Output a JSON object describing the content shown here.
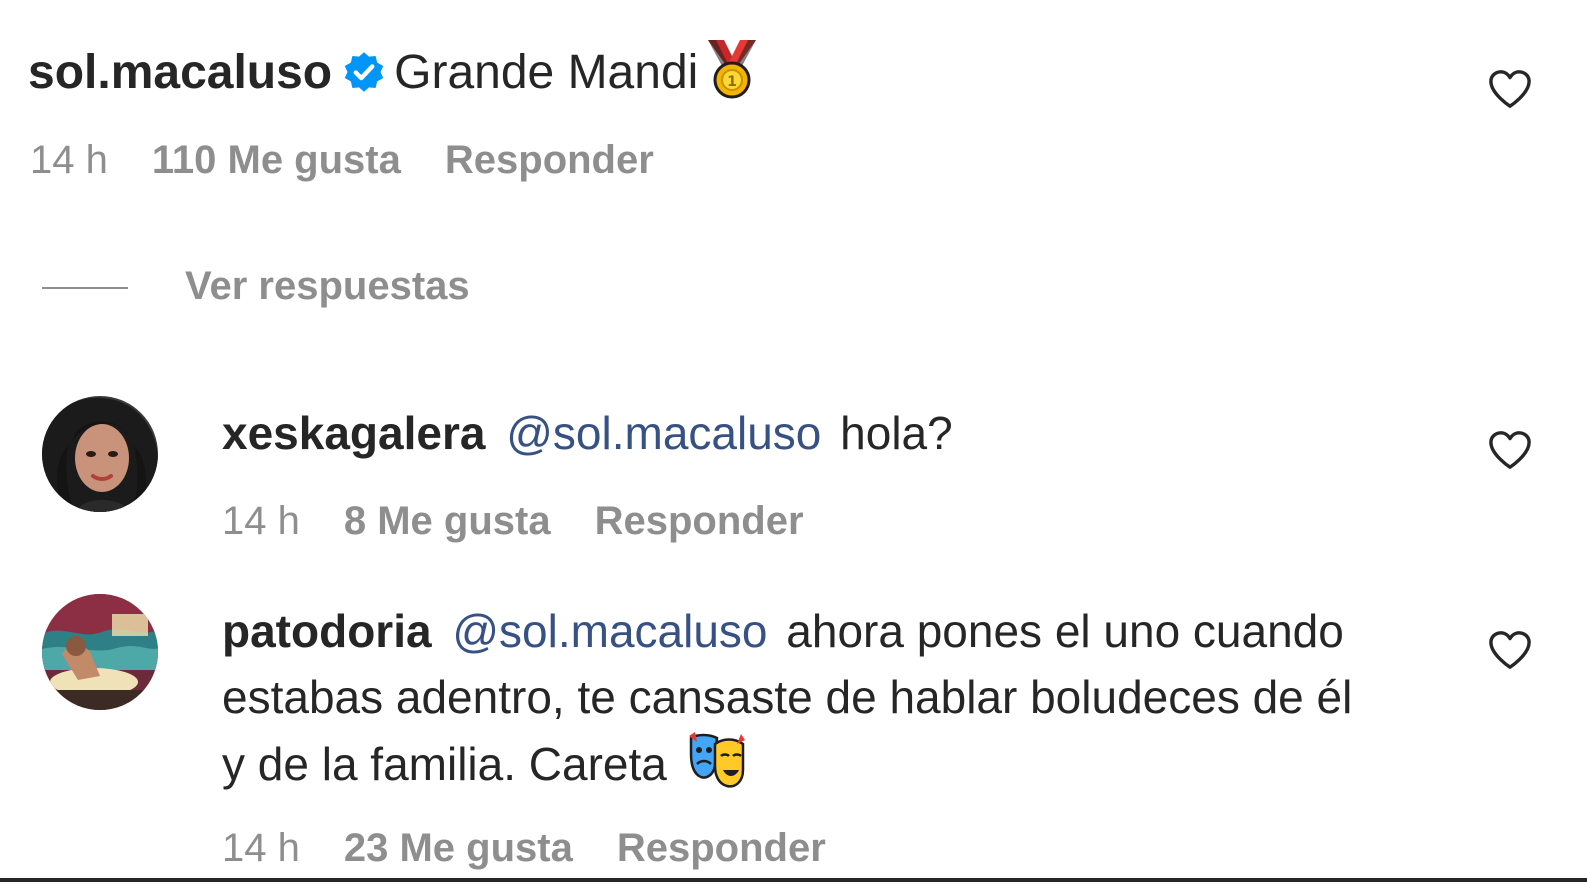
{
  "comments": [
    {
      "username": "sol.macaluso",
      "verified": true,
      "text": "Grande Mandi",
      "emoji": "sports-medal-emoji",
      "time": "14 h",
      "likes": "110 Me gusta",
      "reply": "Responder"
    },
    {
      "username": "xeskagalera",
      "mention": "@sol.macaluso",
      "text": "hola?",
      "time": "14 h",
      "likes": "8 Me gusta",
      "reply": "Responder"
    },
    {
      "username": "patodoria",
      "mention": "@sol.macaluso",
      "text_line1": "ahora pones el uno cuando",
      "text_line2": "estabas adentro, te cansaste de hablar boludeces de él",
      "text_line3": "y de la familia. Careta",
      "emoji": "performing-arts-emoji",
      "time": "14 h",
      "likes": "23 Me gusta",
      "reply": "Responder"
    }
  ],
  "view_replies": "Ver respuestas",
  "colors": {
    "text": "#262626",
    "secondary": "#8e8e8e",
    "mention": "#385185",
    "verified": "#0095f6"
  }
}
